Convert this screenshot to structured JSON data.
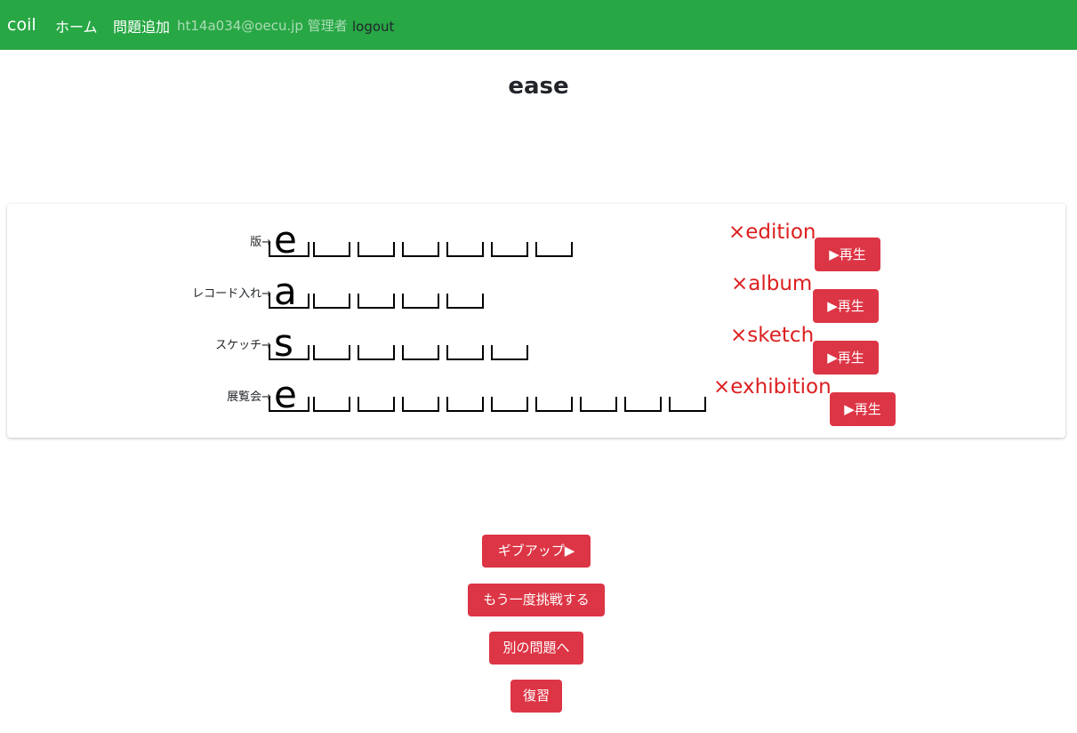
{
  "navbar": {
    "brand": "coil",
    "home": "ホーム",
    "add_problem": "問題追加",
    "user": "ht14a034@oecu.jp 管理者",
    "logout": "logout"
  },
  "title": "ease",
  "rows": [
    {
      "hint": "版→",
      "first": "e",
      "answer": "×edition",
      "play": "▶再生"
    },
    {
      "hint": "レコード入れ→",
      "first": "a",
      "answer": "×album",
      "play": "▶再生"
    },
    {
      "hint": "スケッチ→",
      "first": "s",
      "answer": "×sketch",
      "play": "▶再生"
    },
    {
      "hint": "展覧会→",
      "first": "e",
      "answer": "×exhibition",
      "play": "▶再生"
    }
  ],
  "buttons": {
    "giveup": "ギブアップ▶",
    "retry": "もう一度挑戦する",
    "another": "別の問題へ",
    "review": "復習"
  },
  "colors": {
    "navbar": "#28a745",
    "button": "#dc3545",
    "wrong": "#dc1f1f"
  }
}
